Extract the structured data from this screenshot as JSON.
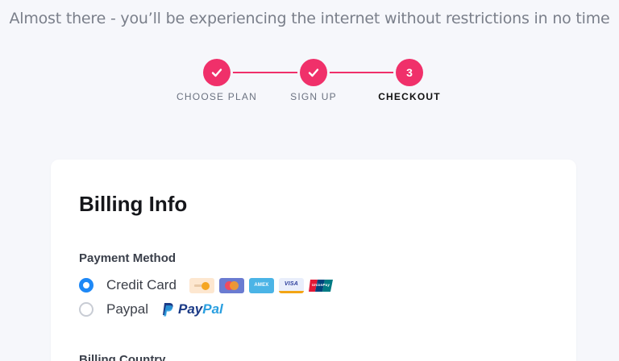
{
  "header": {
    "subtitle": "Almost there - you’ll be experiencing the internet without restrictions in no time"
  },
  "stepper": {
    "steps": [
      {
        "label": "CHOOSE PLAN",
        "state": "completed",
        "icon": "check-icon"
      },
      {
        "label": "SIGN UP",
        "state": "completed",
        "icon": "check-icon"
      },
      {
        "label": "CHECKOUT",
        "state": "current",
        "number": "3"
      }
    ],
    "accent_color": "#f0306a"
  },
  "billing": {
    "title": "Billing Info",
    "payment_method_label": "Payment Method",
    "options": [
      {
        "label": "Credit Card",
        "selected": true,
        "card_icons": [
          {
            "name": "discover-card-icon",
            "text": ""
          },
          {
            "name": "mastercard-icon",
            "text": ""
          },
          {
            "name": "amex-card-icon",
            "text": "AMEX"
          },
          {
            "name": "visa-card-icon",
            "text": "VISA"
          },
          {
            "name": "unionpay-card-icon",
            "text": "UnionPay"
          }
        ]
      },
      {
        "label": "Paypal",
        "selected": false,
        "logo_text_a": "Pay",
        "logo_text_b": "Pal"
      }
    ],
    "billing_country_label": "Billing Country"
  },
  "colors": {
    "radio_selected": "#1e88f6",
    "background": "#f6f7fb"
  }
}
